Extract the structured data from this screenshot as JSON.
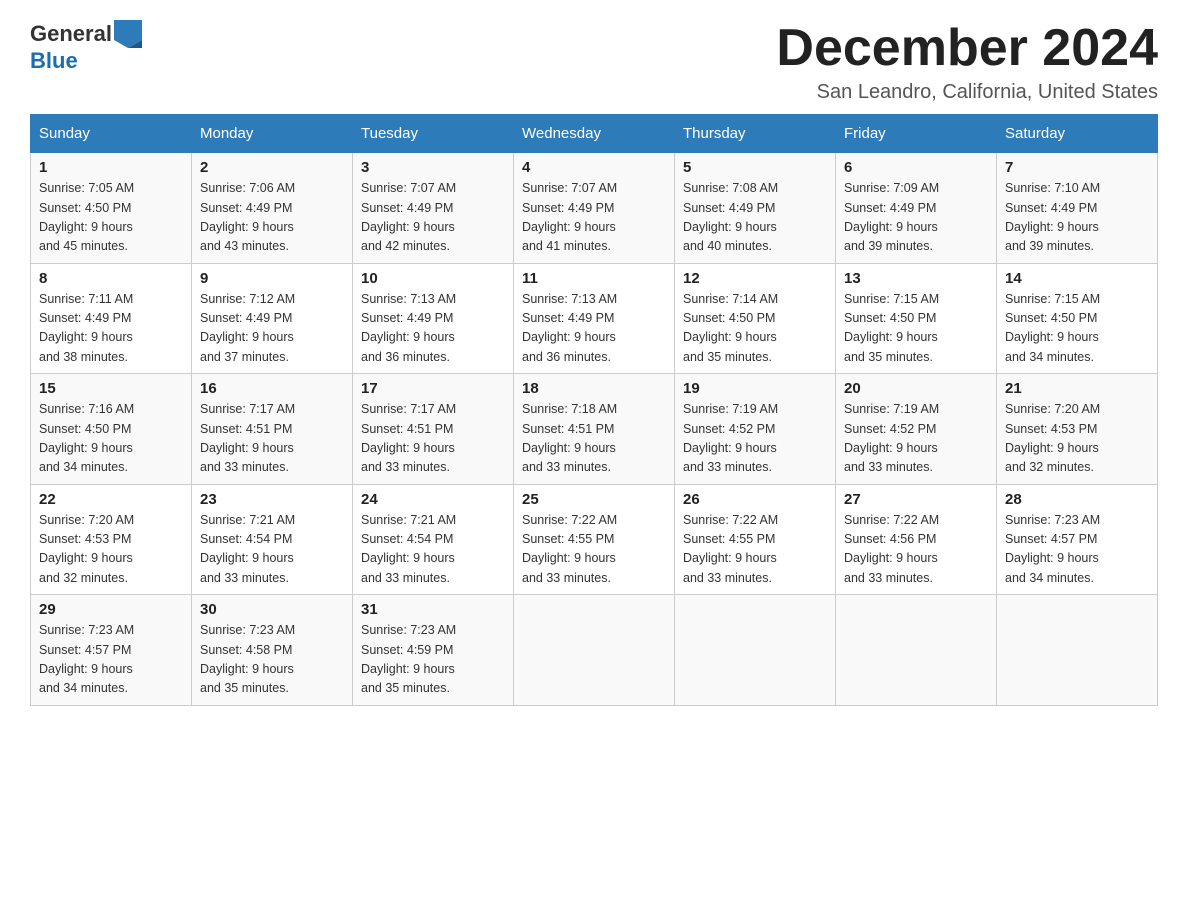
{
  "header": {
    "logo_general": "General",
    "logo_blue": "Blue",
    "month_title": "December 2024",
    "location": "San Leandro, California, United States"
  },
  "weekdays": [
    "Sunday",
    "Monday",
    "Tuesday",
    "Wednesday",
    "Thursday",
    "Friday",
    "Saturday"
  ],
  "weeks": [
    [
      {
        "day": "1",
        "sunrise": "7:05 AM",
        "sunset": "4:50 PM",
        "daylight": "9 hours and 45 minutes."
      },
      {
        "day": "2",
        "sunrise": "7:06 AM",
        "sunset": "4:49 PM",
        "daylight": "9 hours and 43 minutes."
      },
      {
        "day": "3",
        "sunrise": "7:07 AM",
        "sunset": "4:49 PM",
        "daylight": "9 hours and 42 minutes."
      },
      {
        "day": "4",
        "sunrise": "7:07 AM",
        "sunset": "4:49 PM",
        "daylight": "9 hours and 41 minutes."
      },
      {
        "day": "5",
        "sunrise": "7:08 AM",
        "sunset": "4:49 PM",
        "daylight": "9 hours and 40 minutes."
      },
      {
        "day": "6",
        "sunrise": "7:09 AM",
        "sunset": "4:49 PM",
        "daylight": "9 hours and 39 minutes."
      },
      {
        "day": "7",
        "sunrise": "7:10 AM",
        "sunset": "4:49 PM",
        "daylight": "9 hours and 39 minutes."
      }
    ],
    [
      {
        "day": "8",
        "sunrise": "7:11 AM",
        "sunset": "4:49 PM",
        "daylight": "9 hours and 38 minutes."
      },
      {
        "day": "9",
        "sunrise": "7:12 AM",
        "sunset": "4:49 PM",
        "daylight": "9 hours and 37 minutes."
      },
      {
        "day": "10",
        "sunrise": "7:13 AM",
        "sunset": "4:49 PM",
        "daylight": "9 hours and 36 minutes."
      },
      {
        "day": "11",
        "sunrise": "7:13 AM",
        "sunset": "4:49 PM",
        "daylight": "9 hours and 36 minutes."
      },
      {
        "day": "12",
        "sunrise": "7:14 AM",
        "sunset": "4:50 PM",
        "daylight": "9 hours and 35 minutes."
      },
      {
        "day": "13",
        "sunrise": "7:15 AM",
        "sunset": "4:50 PM",
        "daylight": "9 hours and 35 minutes."
      },
      {
        "day": "14",
        "sunrise": "7:15 AM",
        "sunset": "4:50 PM",
        "daylight": "9 hours and 34 minutes."
      }
    ],
    [
      {
        "day": "15",
        "sunrise": "7:16 AM",
        "sunset": "4:50 PM",
        "daylight": "9 hours and 34 minutes."
      },
      {
        "day": "16",
        "sunrise": "7:17 AM",
        "sunset": "4:51 PM",
        "daylight": "9 hours and 33 minutes."
      },
      {
        "day": "17",
        "sunrise": "7:17 AM",
        "sunset": "4:51 PM",
        "daylight": "9 hours and 33 minutes."
      },
      {
        "day": "18",
        "sunrise": "7:18 AM",
        "sunset": "4:51 PM",
        "daylight": "9 hours and 33 minutes."
      },
      {
        "day": "19",
        "sunrise": "7:19 AM",
        "sunset": "4:52 PM",
        "daylight": "9 hours and 33 minutes."
      },
      {
        "day": "20",
        "sunrise": "7:19 AM",
        "sunset": "4:52 PM",
        "daylight": "9 hours and 33 minutes."
      },
      {
        "day": "21",
        "sunrise": "7:20 AM",
        "sunset": "4:53 PM",
        "daylight": "9 hours and 32 minutes."
      }
    ],
    [
      {
        "day": "22",
        "sunrise": "7:20 AM",
        "sunset": "4:53 PM",
        "daylight": "9 hours and 32 minutes."
      },
      {
        "day": "23",
        "sunrise": "7:21 AM",
        "sunset": "4:54 PM",
        "daylight": "9 hours and 33 minutes."
      },
      {
        "day": "24",
        "sunrise": "7:21 AM",
        "sunset": "4:54 PM",
        "daylight": "9 hours and 33 minutes."
      },
      {
        "day": "25",
        "sunrise": "7:22 AM",
        "sunset": "4:55 PM",
        "daylight": "9 hours and 33 minutes."
      },
      {
        "day": "26",
        "sunrise": "7:22 AM",
        "sunset": "4:55 PM",
        "daylight": "9 hours and 33 minutes."
      },
      {
        "day": "27",
        "sunrise": "7:22 AM",
        "sunset": "4:56 PM",
        "daylight": "9 hours and 33 minutes."
      },
      {
        "day": "28",
        "sunrise": "7:23 AM",
        "sunset": "4:57 PM",
        "daylight": "9 hours and 34 minutes."
      }
    ],
    [
      {
        "day": "29",
        "sunrise": "7:23 AM",
        "sunset": "4:57 PM",
        "daylight": "9 hours and 34 minutes."
      },
      {
        "day": "30",
        "sunrise": "7:23 AM",
        "sunset": "4:58 PM",
        "daylight": "9 hours and 35 minutes."
      },
      {
        "day": "31",
        "sunrise": "7:23 AM",
        "sunset": "4:59 PM",
        "daylight": "9 hours and 35 minutes."
      },
      null,
      null,
      null,
      null
    ]
  ],
  "labels": {
    "sunrise": "Sunrise:",
    "sunset": "Sunset:",
    "daylight": "Daylight:"
  }
}
